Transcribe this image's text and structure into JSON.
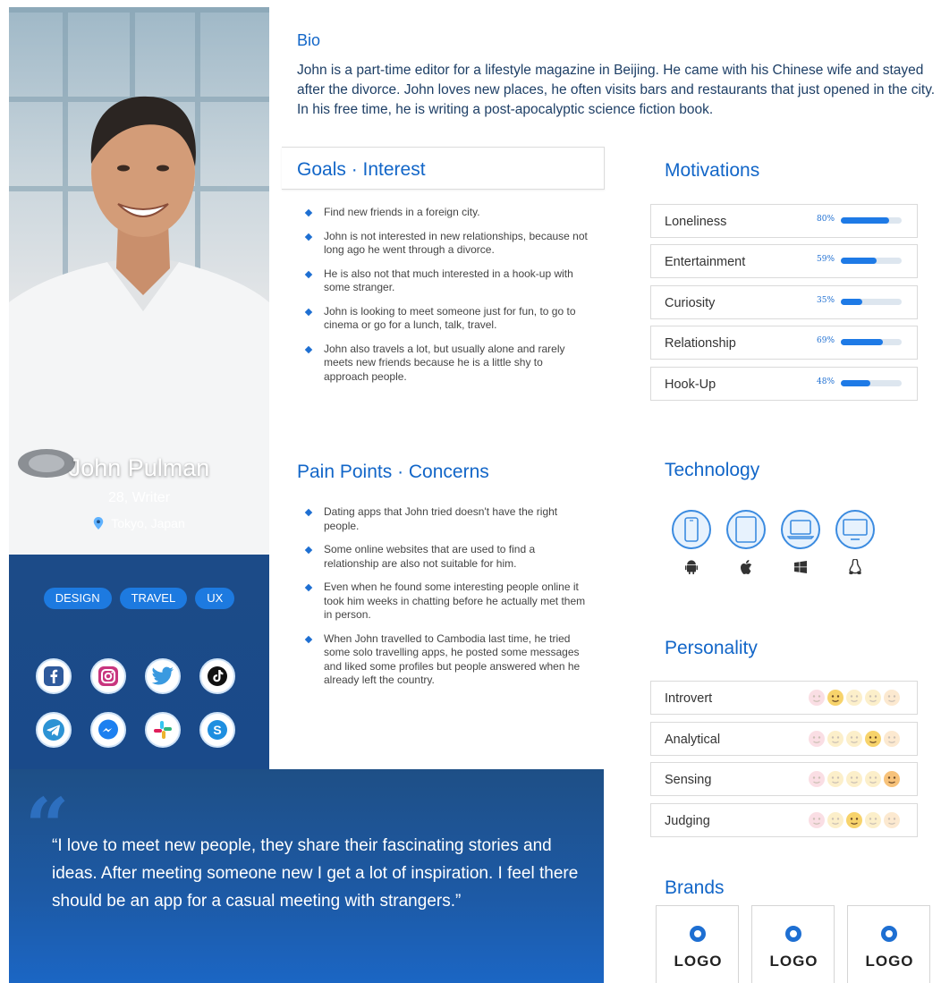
{
  "profile": {
    "name": "John Pulman",
    "age_role": "28, Writer",
    "location": "Tokyo, Japan",
    "tags": [
      "DESIGN",
      "TRAVEL",
      "UX"
    ],
    "socials": [
      "facebook-icon",
      "instagram-icon",
      "twitter-icon",
      "tiktok-icon",
      "telegram-icon",
      "messenger-icon",
      "slack-icon",
      "skype-icon"
    ]
  },
  "bio": {
    "title": "Bio",
    "text": "John is a part-time editor for a lifestyle magazine in Beijing. He came with his Chinese wife and stayed after the divorce. John loves new places, he often visits bars and restaurants that just opened in the city. In his free time, he is writing a post-apocalyptic science fiction book."
  },
  "goals": {
    "title": "Goals · Interest",
    "items": [
      "Find new friends in a foreign city.",
      "John is not interested in new relationships, because not long ago he went through a divorce.",
      "He is also not that much interested in a hook-up with some stranger.",
      "John is looking to meet someone just for fun, to go to cinema or go for a lunch, talk, travel.",
      "John also travels a lot, but usually alone and rarely meets new friends because he is a little shy to approach people."
    ]
  },
  "pain": {
    "title": "Pain Points · Concerns",
    "items": [
      "Dating apps that John tried doesn't have the right people.",
      "Some online websites that are used to find a relationship are also not suitable for him.",
      "Even when he found some interesting people online it took him weeks in chatting before he actually met them in person.",
      "When John travelled to Cambodia last time, he tried some solo travelling apps, he posted some messages and liked some profiles but people answered when he already left the country."
    ]
  },
  "motivations": {
    "title": "Motivations",
    "items": [
      {
        "label": "Loneliness",
        "pct_label": "80%",
        "value": 0.8
      },
      {
        "label": "Entertainment",
        "pct_label": "59%",
        "value": 0.59
      },
      {
        "label": "Curiosity",
        "pct_label": "35%",
        "value": 0.35
      },
      {
        "label": "Relationship",
        "pct_label": "69%",
        "value": 0.69
      },
      {
        "label": "Hook-Up",
        "pct_label": "48%",
        "value": 0.48
      }
    ],
    "accent": "#1e7ae6"
  },
  "technology": {
    "title": "Technology",
    "devices": [
      "phone-icon",
      "tablet-icon",
      "laptop-icon",
      "desktop-icon"
    ],
    "os": [
      "android-icon",
      "apple-icon",
      "windows-icon",
      "linux-icon"
    ]
  },
  "personality": {
    "title": "Personality",
    "items": [
      {
        "label": "Introvert",
        "active_index": 1
      },
      {
        "label": "Analytical",
        "active_index": 3
      },
      {
        "label": "Sensing",
        "active_index": 4
      },
      {
        "label": "Judging",
        "active_index": 2
      }
    ]
  },
  "brands": {
    "title": "Brands",
    "items": [
      "LOGO",
      "LOGO",
      "LOGO"
    ]
  },
  "quote": {
    "mark": "“",
    "text": "“I love to meet new people, they share their fascinating stories and ideas. After meeting someone new I get a lot of inspiration. I feel there should be an app for a casual meeting with strangers.”"
  },
  "colors": {
    "heading": "#1266c8",
    "panel": "#1e4f86",
    "tag": "#1d7ae0"
  }
}
